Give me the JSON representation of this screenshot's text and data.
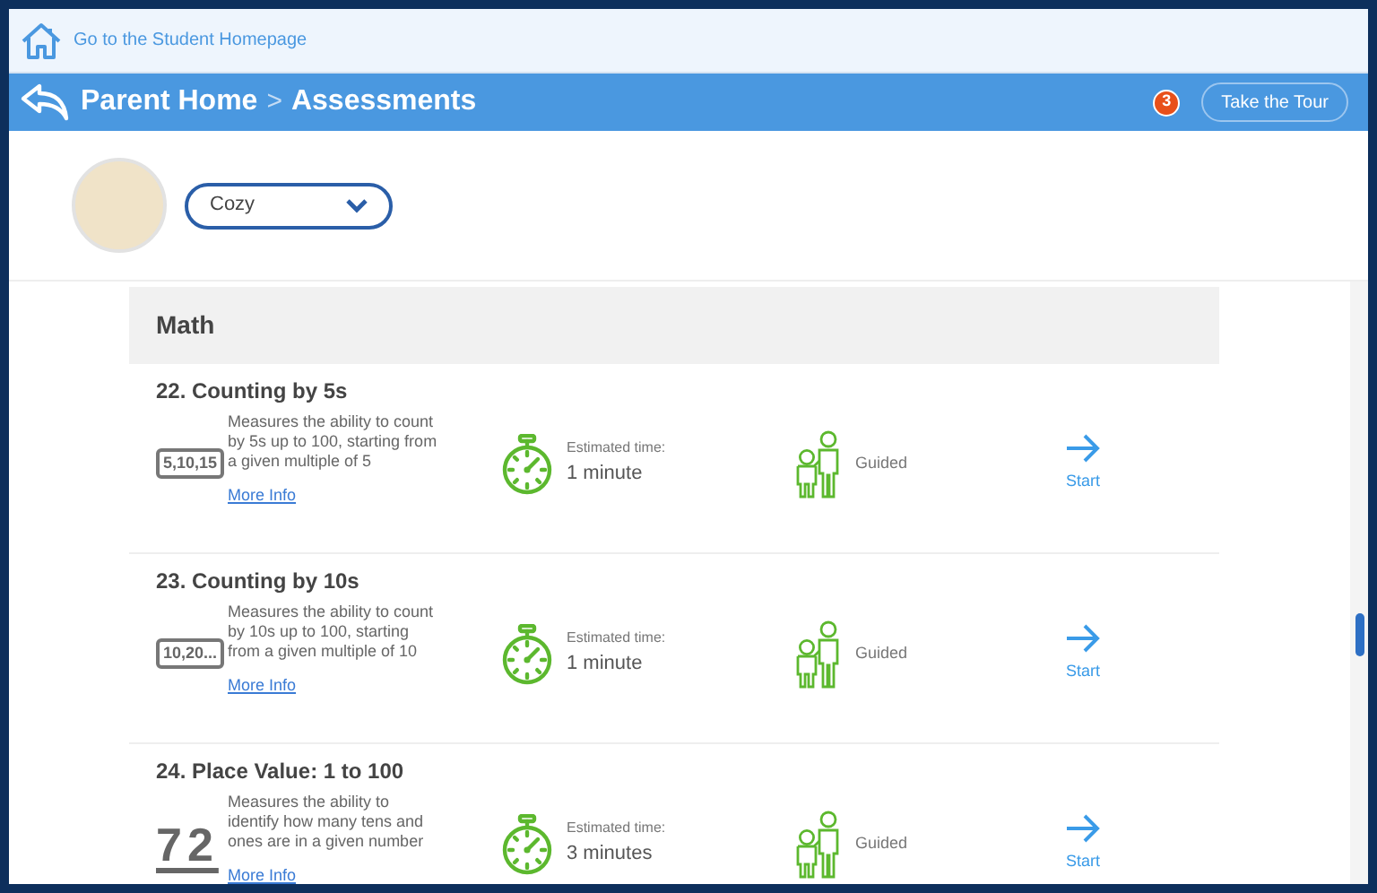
{
  "top_link": {
    "label": "Go to the Student Homepage"
  },
  "header": {
    "breadcrumb": [
      "Parent Home",
      "Assessments"
    ],
    "separator": ">",
    "notification_count": "3",
    "tour_button": "Take the Tour"
  },
  "student_select": {
    "value": "Cozy"
  },
  "section": {
    "title": "Math"
  },
  "assessments": [
    {
      "title": "22. Counting by 5s",
      "kind": "boxed",
      "icon_text": "5,10,15",
      "description": "Measures the ability to count by 5s up to 100, starting from a given multiple of 5",
      "more_info": "More Info",
      "time_label": "Estimated time:",
      "time_value": "1 minute",
      "mode": "Guided",
      "start": "Start"
    },
    {
      "title": "23. Counting by 10s",
      "kind": "boxed",
      "icon_text": "10,20...",
      "description": "Measures the ability to count by 10s up to 100, starting from a given multiple of 10",
      "more_info": "More Info",
      "time_label": "Estimated time:",
      "time_value": "1 minute",
      "mode": "Guided",
      "start": "Start"
    },
    {
      "title": "24. Place Value: 1 to 100",
      "kind": "digits",
      "icon_text": "72",
      "description": "Measures the ability to identify how many tens and ones are in a given number",
      "more_info": "More Info",
      "time_label": "Estimated time:",
      "time_value": "3 minutes",
      "mode": "Guided",
      "start": "Start"
    }
  ]
}
